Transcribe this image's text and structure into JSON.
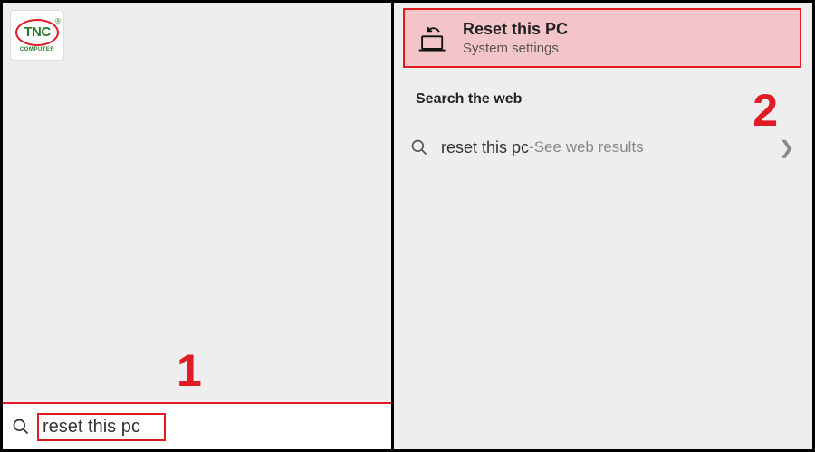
{
  "logo": {
    "brand": "TNC",
    "subline": "COMPUTER"
  },
  "left": {
    "search_value": "reset this pc",
    "step_label": "1"
  },
  "right": {
    "best_match": {
      "title": "Reset this PC",
      "subtitle": "System settings"
    },
    "section_header": "Search the web",
    "web_result": {
      "query": "reset this pc",
      "hint_prefix": " - ",
      "hint": "See web results"
    },
    "step_label": "2"
  }
}
